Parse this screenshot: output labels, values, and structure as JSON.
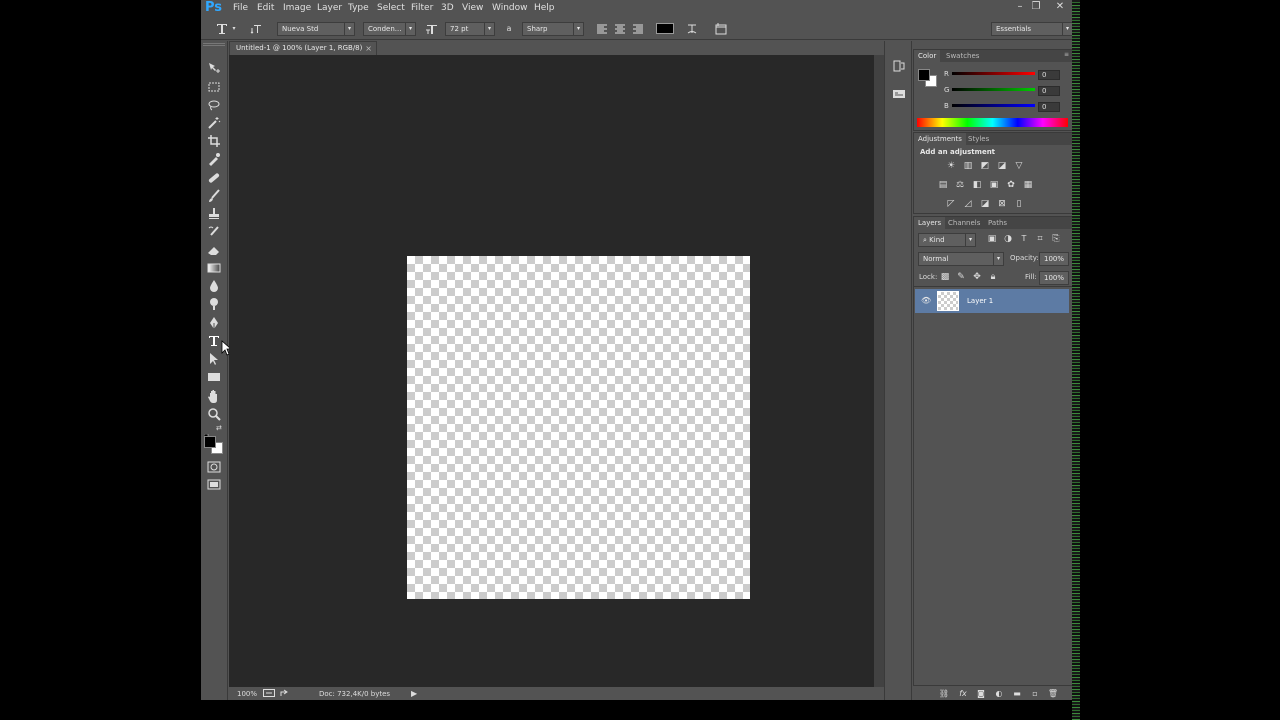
{
  "app": {
    "logo": "Ps"
  },
  "menu": [
    "File",
    "Edit",
    "Image",
    "Layer",
    "Type",
    "Select",
    "Filter",
    "3D",
    "View",
    "Window",
    "Help"
  ],
  "window_controls": [
    "–",
    "❐",
    "✕"
  ],
  "options_bar": {
    "font_family": "Nueva Std",
    "font_style": "Conden...",
    "font_size": "72 pt",
    "aa_label": "a",
    "antialias": "Sharp",
    "workspace": "Essentials",
    "text_color": "#000000"
  },
  "document": {
    "tab_title": "Untitled-1 @ 100% (Layer 1, RGB/8)",
    "tab_close": "×",
    "status_zoom": "100%",
    "status_doc": "Doc: 732,4K/0 bytes"
  },
  "color_panel": {
    "tabs": [
      "Color",
      "Swatches"
    ],
    "channels": [
      {
        "label": "R",
        "value": "0",
        "color": "#ff0000"
      },
      {
        "label": "G",
        "value": "0",
        "color": "#00cc00"
      },
      {
        "label": "B",
        "value": "0",
        "color": "#0000ff"
      }
    ]
  },
  "adjustments_panel": {
    "tabs": [
      "Adjustments",
      "Styles"
    ],
    "heading": "Add an adjustment"
  },
  "layers_panel": {
    "tabs": [
      "Layers",
      "Channels",
      "Paths"
    ],
    "filter": "Kind",
    "blend_mode": "Normal",
    "opacity_label": "Opacity:",
    "opacity": "100%",
    "lock_label": "Lock:",
    "fill_label": "Fill:",
    "fill": "100%",
    "layers": [
      {
        "name": "Layer 1",
        "visible": true,
        "selected": true
      }
    ]
  },
  "colors": {
    "ui_bg": "#535353",
    "doc_bg": "#282828",
    "selection": "#5d7ba4",
    "accent_logo": "#31a8ff"
  }
}
